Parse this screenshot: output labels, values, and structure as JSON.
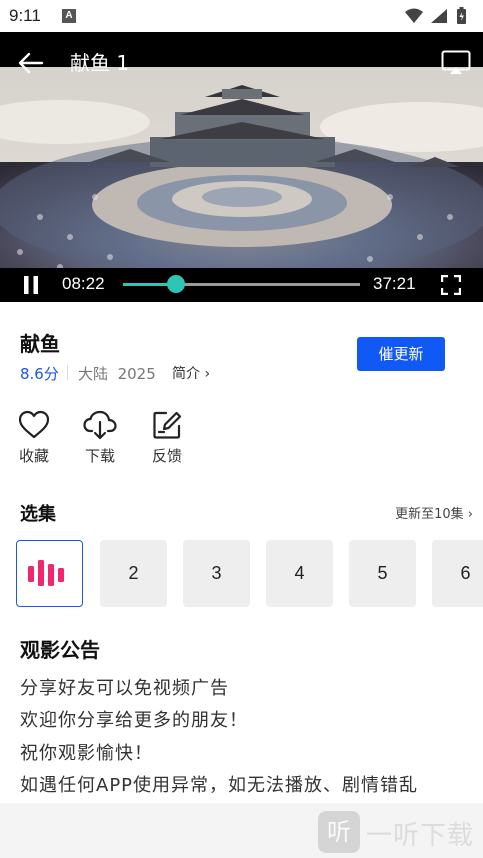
{
  "status": {
    "time": "9:11",
    "notification": "A"
  },
  "player": {
    "title": "献鱼 1",
    "current_time": "08:22",
    "total_time": "37:21",
    "progress": 0.225,
    "accent": "#2ec4b6"
  },
  "show": {
    "title": "献鱼",
    "score": "8.6分",
    "region": "大陆",
    "year": "2025",
    "intro_label": "简介 ›",
    "update_button": "催更新"
  },
  "actions": [
    {
      "label": "收藏",
      "icon": "heart-icon"
    },
    {
      "label": "下载",
      "icon": "cloud-download-icon"
    },
    {
      "label": "反馈",
      "icon": "edit-icon"
    }
  ],
  "episodes": {
    "title": "选集",
    "more": "更新至10集 ›",
    "items": [
      "2",
      "3",
      "4",
      "5",
      "6"
    ],
    "playing_icon": "playing-bars-icon"
  },
  "notice": {
    "title": "观影公告",
    "lines": [
      "分享好友可以免视频广告",
      "欢迎你分享给更多的朋友！",
      "祝你观影愉快！",
      "如遇任何APP使用异常，如无法播放、剧情错乱"
    ]
  },
  "watermark": {
    "box_char": "听",
    "text": "一听下载"
  }
}
